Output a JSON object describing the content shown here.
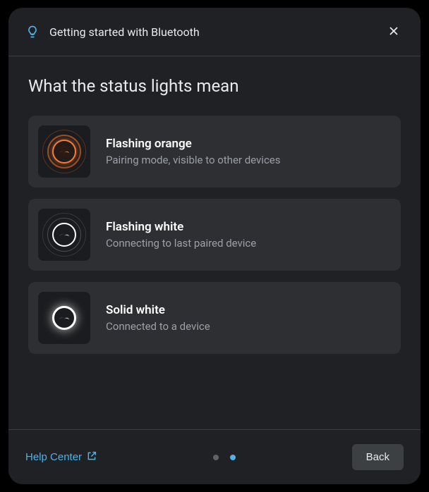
{
  "header": {
    "title": "Getting started with Bluetooth"
  },
  "body": {
    "heading": "What the status lights mean",
    "items": [
      {
        "title": "Flashing orange",
        "desc": "Pairing mode, visible to other devices"
      },
      {
        "title": "Flashing white",
        "desc": "Connecting to last paired device"
      },
      {
        "title": "Solid white",
        "desc": "Connected to a device"
      }
    ]
  },
  "footer": {
    "help_label": "Help Center",
    "back_label": "Back"
  },
  "pager": {
    "total": 2,
    "active_index": 1
  },
  "colors": {
    "accent": "#4fb3e5",
    "orange": "#ff7a2d"
  }
}
